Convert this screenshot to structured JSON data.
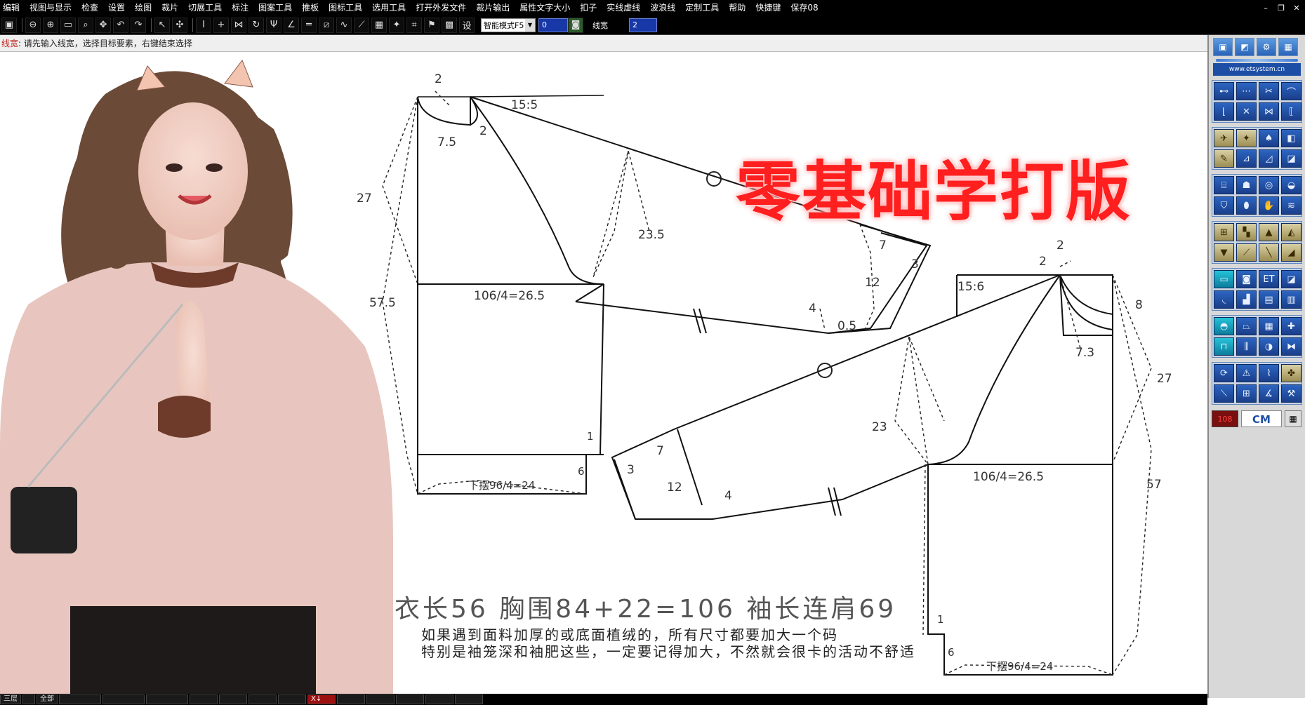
{
  "menubar": {
    "items": [
      "编辑",
      "视图与显示",
      "检查",
      "设置",
      "绘图",
      "裁片",
      "切展工具",
      "标注",
      "图案工具",
      "推板",
      "图标工具",
      "选用工具",
      "打开外发文件",
      "裁片输出",
      "属性文字大小",
      "扣子",
      "实线虚线",
      "波浪线",
      "定制工具",
      "帮助",
      "快捷键",
      "保存08"
    ]
  },
  "toolbar": {
    "mode_select": "智能模式F5",
    "value_field": "0",
    "line_width_label": "线宽",
    "line_width_value": "2",
    "set_label": "设"
  },
  "prompt": {
    "key": "线宽",
    "text": ": 请先输入线宽，选择目标要素，右键结束选择"
  },
  "headline": "零基础学打版",
  "pattern": {
    "front": {
      "neck_top": "2",
      "neck_width": "7.5",
      "neck_drop": "2",
      "shoulder_slope": "15:5",
      "armhole_depth": "27",
      "length": "57.5",
      "armhole_curve": "23.5",
      "bust": "106/4=26.5",
      "hem": "下摆96/4=24",
      "hem_side": "6",
      "side_mark": "1",
      "cuff_width": "7",
      "cuff_side": "3",
      "cuff_len": "12",
      "sleeve_hem": "4",
      "sleeve_adj": "0.5"
    },
    "back": {
      "neck_top": "2",
      "neck_drop": "2",
      "shoulder_slope": "15:6",
      "neck_width": "7.3",
      "neck_side": "8",
      "armhole_depth": "27",
      "length": "57",
      "armhole_curve": "23",
      "bust": "106/4=26.5",
      "hem": "下摆96/4=24",
      "hem_side": "6",
      "side_mark": "1",
      "cuff_width": "7",
      "cuff_side": "3",
      "cuff_len": "12",
      "sleeve_hem": "4"
    }
  },
  "measurements": "衣长56   胸围84+22=106   袖长连肩69",
  "note_line1": "如果遇到面料加厚的或底面植绒的，所有尺寸都要加大一个码",
  "note_line2": "特别是袖笼深和袖肥这些，一定要记得加大，不然就会很卡的活动不舒适",
  "right_panel": {
    "site": "www.etsystem.cn",
    "red_label": "108",
    "cm_label": "CM"
  },
  "statusbar": {
    "cells": [
      "三层",
      "",
      "全部",
      "",
      "",
      "",
      "",
      "",
      "",
      "",
      "X↓",
      "",
      "",
      "",
      "",
      ""
    ]
  },
  "colors": {
    "menubar_bg": "#000000",
    "headline": "#ff1f1f",
    "tool_blue": "#2c65c1",
    "prompt_key": "#c0271e"
  }
}
